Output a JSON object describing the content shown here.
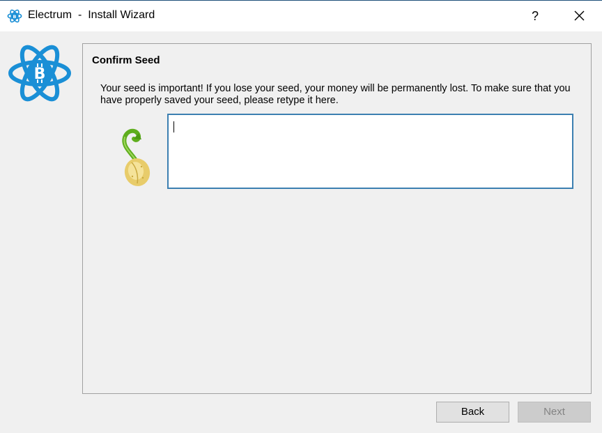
{
  "window": {
    "title": "Electrum  -  Install Wizard",
    "help_label": "?",
    "close_icon": "close-icon",
    "app_icon": "electrum-bitcoin-logo-icon"
  },
  "panel": {
    "title": "Confirm Seed",
    "message": "Your seed is important! If you lose your seed, your money will be permanently lost. To make sure that you have properly saved your seed, please retype it here.",
    "seed_icon": "sprouting-seed-icon",
    "seed_input": {
      "value": "",
      "placeholder": ""
    }
  },
  "buttons": {
    "back": "Back",
    "next": "Next",
    "next_enabled": false
  },
  "colors": {
    "accent": "#3c7fb1",
    "logo_blue": "#1a8fd6",
    "disabled_text": "#838383"
  }
}
